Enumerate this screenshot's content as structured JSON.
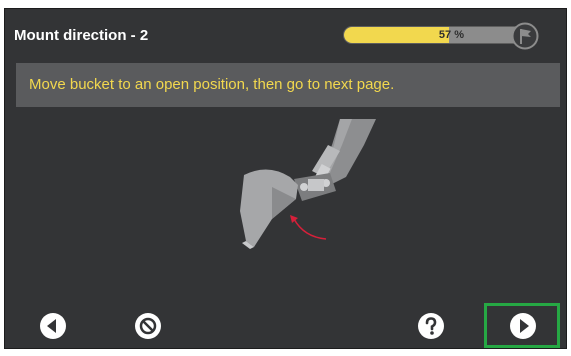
{
  "header": {
    "title": "Mount direction - 2",
    "progress": {
      "label": "57 %",
      "value": 57
    }
  },
  "banner": {
    "instruction": "Move bucket to an open position, then go to next page."
  },
  "illustration": {
    "icon": "excavator-bucket-illustration",
    "arrow_color": "#d6203a"
  },
  "footer": {
    "buttons": [
      {
        "name": "back-button",
        "icon": "back-arrow-icon"
      },
      {
        "name": "cancel-button",
        "icon": "cancel-icon"
      },
      {
        "name": "help-button",
        "icon": "help-icon"
      },
      {
        "name": "next-button",
        "icon": "next-arrow-icon"
      }
    ]
  },
  "colors": {
    "background": "#333436",
    "banner": "#5a5b5d",
    "accent_yellow": "#f2d84e",
    "highlight_green": "#26a844"
  }
}
